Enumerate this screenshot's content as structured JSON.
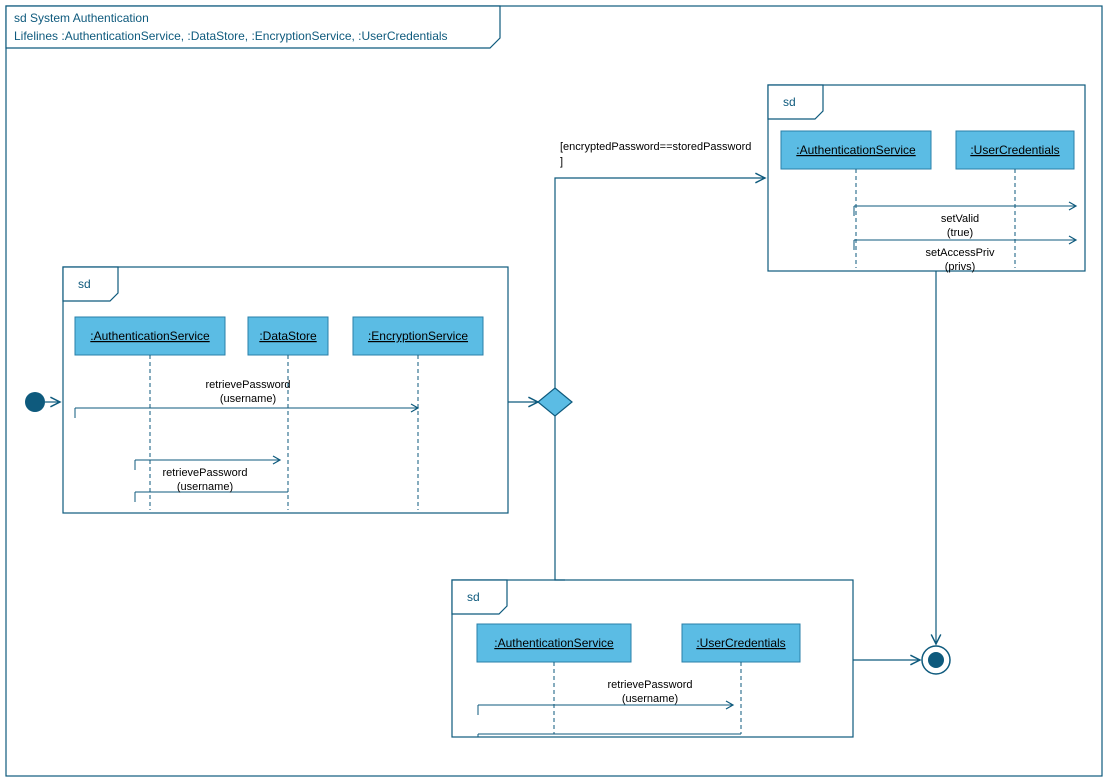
{
  "outer": {
    "tab1": "sd System Authentication",
    "tab2": "Lifelines :AuthenticationService, :DataStore, :EncryptionService, :UserCredentials"
  },
  "frame1": {
    "label": "sd",
    "lifelines": {
      "a": ":AuthenticationService",
      "b": ":DataStore",
      "c": ":EncryptionService"
    },
    "msg1": {
      "name": "retrievePassword",
      "arg": "(username)"
    },
    "msg2": {
      "name": "retrievePassword",
      "arg": "(username)"
    }
  },
  "guard": {
    "line1": "[encryptedPassword==storedPassword",
    "line2": "]"
  },
  "frame2": {
    "label": "sd",
    "lifelines": {
      "a": ":AuthenticationService",
      "b": ":UserCredentials"
    },
    "msg1": {
      "name": "setValid",
      "arg": "(true)"
    },
    "msg2": {
      "name": "setAccessPriv",
      "arg": "(privs)"
    }
  },
  "frame3": {
    "label": "sd",
    "lifelines": {
      "a": ":AuthenticationService",
      "b": ":UserCredentials"
    },
    "msg1": {
      "name": "retrievePassword",
      "arg": "(username)"
    }
  }
}
